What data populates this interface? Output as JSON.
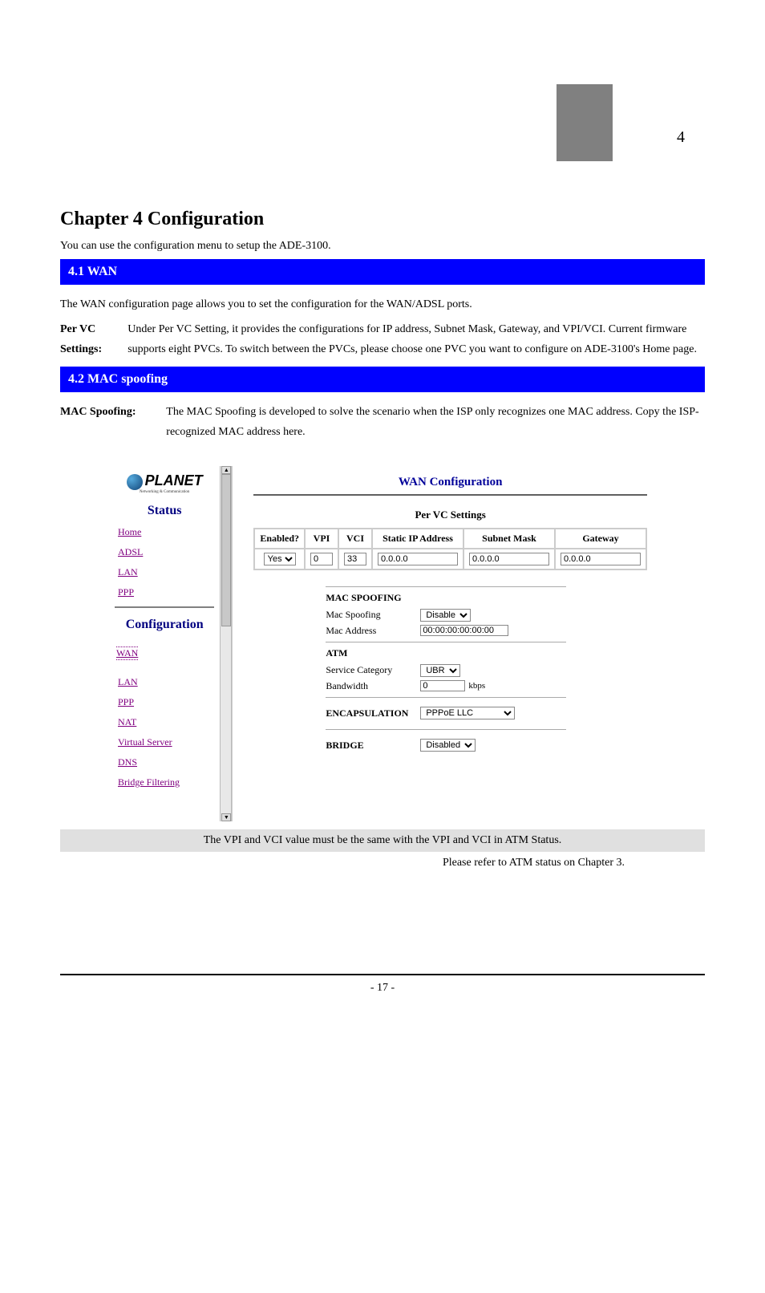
{
  "page_number_top": "4",
  "chapter_title": "Chapter 4 Configuration",
  "chapter_desc": "You can use the configuration menu to setup the ADE-3100.",
  "sections": {
    "wan_heading": "4.1 WAN",
    "wan_intro": "The WAN configuration page allows you to set the configuration for the WAN/ADSL ports.",
    "per_vc_label": "Per VC Settings:",
    "per_vc_def": "Under Per VC Setting, it provides the configurations for IP address, Subnet Mask, Gateway, and VPI/VCI. Current firmware supports eight PVCs. To switch between the PVCs, please choose one PVC you want to configure on ADE-3100's Home page.",
    "mac_heading": "4.2 MAC spoofing",
    "mac_label": "MAC Spoofing:",
    "mac_def": "The MAC Spoofing is developed to solve the scenario when the ISP only recognizes one MAC address. Copy the ISP-recognized MAC address here."
  },
  "caption_line1": "The VPI and VCI value must be the same with the VPI and VCI in ATM Status.",
  "caption_line2_bold": "Please refer to ATM status on Chapter 3.",
  "screenshot": {
    "logo_text": "PLANET",
    "logo_sub": "Networking & Communication",
    "sidebar": {
      "status_heading": "Status",
      "status_items": [
        "Home",
        "ADSL",
        "LAN",
        "PPP"
      ],
      "config_heading": "Configuration",
      "config_items": [
        "WAN",
        "LAN",
        "PPP",
        "NAT",
        "Virtual Server",
        "DNS",
        "Bridge Filtering"
      ]
    },
    "main": {
      "title": "WAN Configuration",
      "per_vc_heading": "Per VC Settings",
      "table_headers": [
        "Enabled?",
        "VPI",
        "VCI",
        "Static IP Address",
        "Subnet Mask",
        "Gateway"
      ],
      "enabled_value": "Yes",
      "vpi_value": "0",
      "vci_value": "33",
      "static_ip_value": "0.0.0.0",
      "subnet_value": "0.0.0.0",
      "gateway_value": "0.0.0.0",
      "mac_spoofing_title": "MAC SPOOFING",
      "mac_spoofing_label": "Mac Spoofing",
      "mac_spoofing_value": "Disable",
      "mac_address_label": "Mac Address",
      "mac_address_value": "00:00:00:00:00:00",
      "atm_title": "ATM",
      "service_category_label": "Service Category",
      "service_category_value": "UBR",
      "bandwidth_label": "Bandwidth",
      "bandwidth_value": "0",
      "bandwidth_unit": "kbps",
      "encapsulation_title": "ENCAPSULATION",
      "encapsulation_value": "PPPoE LLC",
      "bridge_title": "BRIDGE",
      "bridge_value": "Disabled"
    }
  },
  "footer_page": "- 17 -"
}
